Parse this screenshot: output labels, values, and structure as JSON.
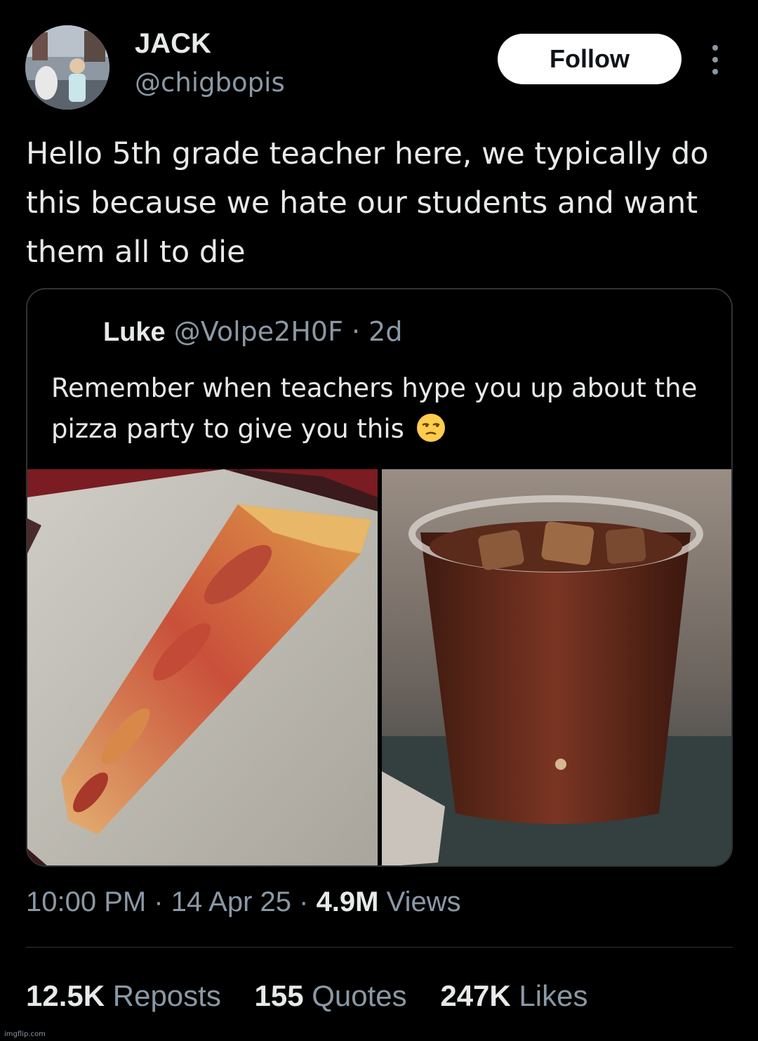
{
  "tweet": {
    "author": {
      "name": "JACK",
      "handle": "@chigbopis"
    },
    "follow_label": "Follow",
    "text": "Hello 5th grade teacher here, we typically do this because we hate our students and want them all to die",
    "timestamp": "10:00 PM · 14 Apr 25 · ",
    "views_count": "4.9M",
    "views_label": " Views"
  },
  "quoted": {
    "name": "Luke",
    "meta": "@Volpe2H0F · 2d",
    "text": "Remember when teachers hype you up about the pizza party to give you this",
    "emoji": "unamused-face-icon"
  },
  "stats": {
    "reposts_count": "12.5K",
    "reposts_label": "Reposts",
    "quotes_count": "155",
    "quotes_label": "Quotes",
    "likes_count": "247K",
    "likes_label": "Likes"
  },
  "watermark": "imgflip.com",
  "colors": {
    "background": "#000000",
    "text": "#e7e9ea",
    "secondary": "#8b98a5",
    "border": "#2f3336",
    "follow_bg": "#ffffff"
  }
}
